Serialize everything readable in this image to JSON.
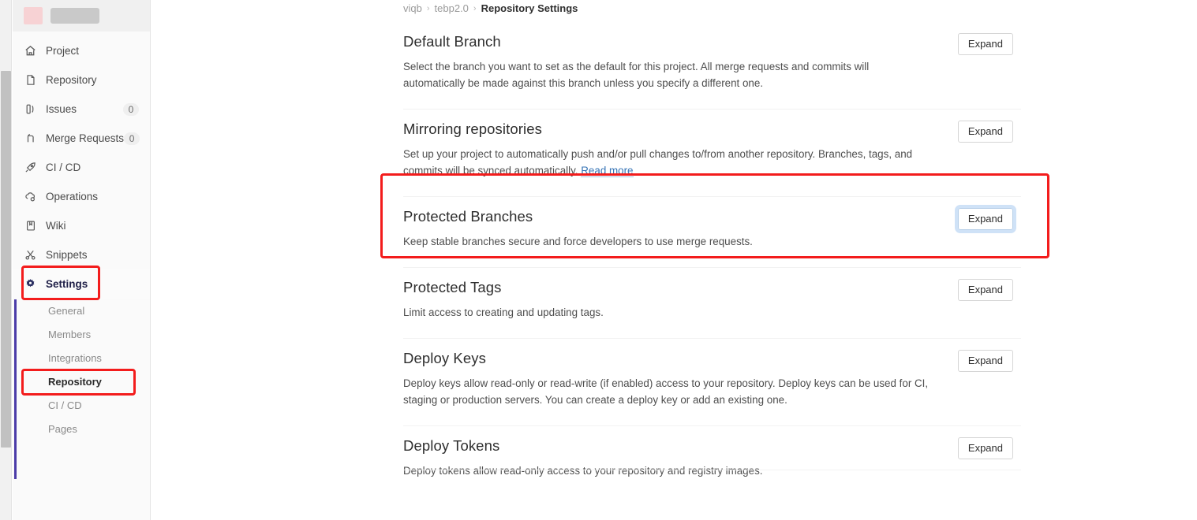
{
  "sidebar": {
    "logo_name": "logo-square",
    "project_name_redacted": true,
    "items": [
      {
        "label": "Project",
        "icon": "home-icon",
        "badge": null,
        "active": false
      },
      {
        "label": "Repository",
        "icon": "file-document-icon",
        "badge": null,
        "active": false
      },
      {
        "label": "Issues",
        "icon": "issues-icon",
        "badge": "0",
        "active": false
      },
      {
        "label": "Merge Requests",
        "icon": "merge-request-icon",
        "badge": "0",
        "active": false
      },
      {
        "label": "CI / CD",
        "icon": "rocket-icon",
        "badge": null,
        "active": false
      },
      {
        "label": "Operations",
        "icon": "cloud-gear-icon",
        "badge": null,
        "active": false
      },
      {
        "label": "Wiki",
        "icon": "book-icon",
        "badge": null,
        "active": false
      },
      {
        "label": "Snippets",
        "icon": "scissors-icon",
        "badge": null,
        "active": false
      },
      {
        "label": "Settings",
        "icon": "gear-icon",
        "badge": null,
        "active": true
      }
    ],
    "subitems": [
      {
        "label": "General",
        "active": false
      },
      {
        "label": "Members",
        "active": false
      },
      {
        "label": "Integrations",
        "active": false
      },
      {
        "label": "Repository",
        "active": true
      },
      {
        "label": "CI / CD",
        "active": false
      },
      {
        "label": "Pages",
        "active": false
      }
    ]
  },
  "breadcrumb": {
    "items": [
      "viqb",
      "tebp2.0",
      "Repository Settings"
    ],
    "separator": "›"
  },
  "main": {
    "sections": [
      {
        "title": "Default Branch",
        "description": "Select the branch you want to set as the default for this project. All merge requests and commits will automatically be made against this branch unless you specify a different one.",
        "link_text": null,
        "button_label": "Expand",
        "focused": false,
        "highlighted": false
      },
      {
        "title": "Mirroring repositories",
        "description": "Set up your project to automatically push and/or pull changes to/from another repository. Branches, tags, and commits will be synced automatically.",
        "link_text": "Read more",
        "button_label": "Expand",
        "focused": false,
        "highlighted": false
      },
      {
        "title": "Protected Branches",
        "description": "Keep stable branches secure and force developers to use merge requests.",
        "link_text": null,
        "button_label": "Expand",
        "focused": true,
        "highlighted": true
      },
      {
        "title": "Protected Tags",
        "description": "Limit access to creating and updating tags.",
        "link_text": null,
        "button_label": "Expand",
        "focused": false,
        "highlighted": false
      },
      {
        "title": "Deploy Keys",
        "description": "Deploy keys allow read-only or read-write (if enabled) access to your repository. Deploy keys can be used for CI, staging or production servers. You can create a deploy key or add an existing one.",
        "link_text": null,
        "button_label": "Expand",
        "focused": false,
        "highlighted": false
      },
      {
        "title": "Deploy Tokens",
        "description": "Deploy tokens allow read-only access to your repository and registry images.",
        "link_text": null,
        "button_label": "Expand",
        "focused": false,
        "highlighted": false
      }
    ]
  },
  "annotations": {
    "color": "#f31c1c",
    "boxes": [
      "settings-nav-item",
      "repository-subnav-item",
      "protected-branches-section"
    ]
  }
}
